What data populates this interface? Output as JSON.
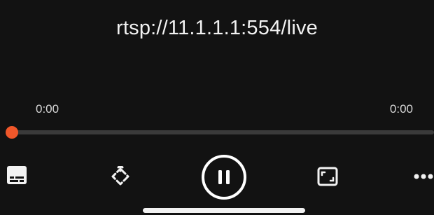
{
  "player": {
    "title": "rtsp://11.1.1.1:554/live",
    "time_elapsed": "0:00",
    "time_total": "0:00",
    "progress": 0.0
  },
  "controls": {
    "subtitles_icon": "subtitles-icon",
    "rotate_icon": "rotate-icon",
    "pause_icon": "pause-icon",
    "aspect_icon": "aspect-ratio-icon",
    "more_icon": "more-icon"
  },
  "colors": {
    "background": "#121212",
    "accent": "#f0572a",
    "text": "#f2f2f2",
    "track": "#3a3a3a"
  }
}
